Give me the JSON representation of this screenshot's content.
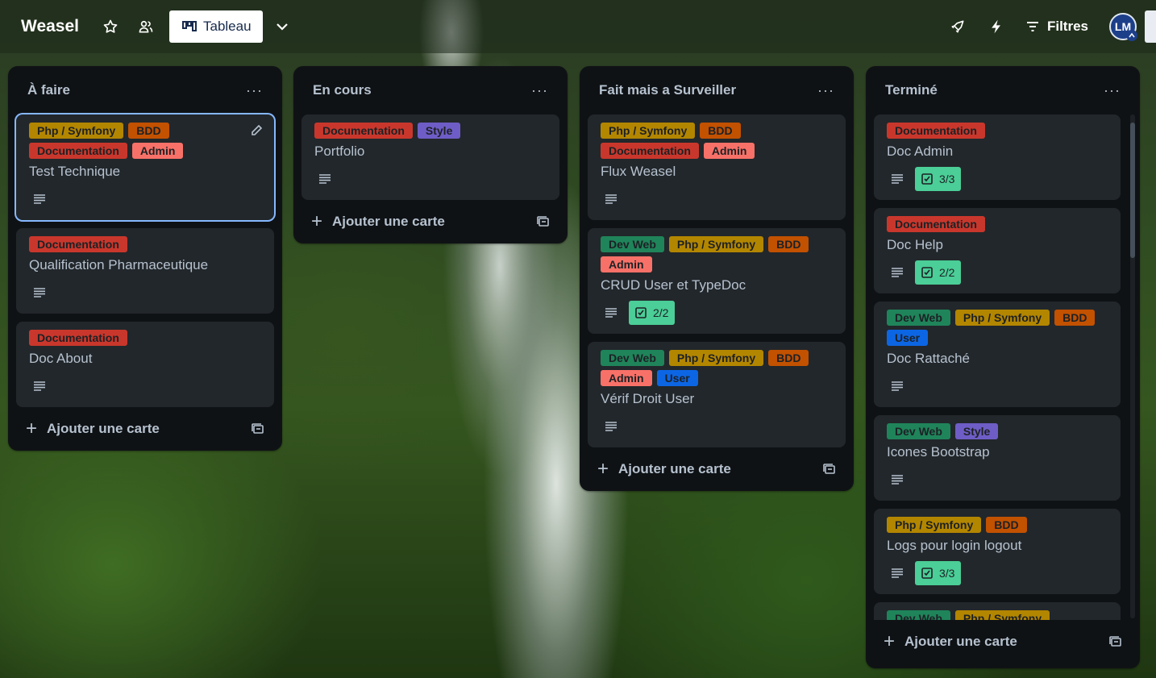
{
  "header": {
    "brand": "Weasel",
    "view_label": "Tableau",
    "filters_label": "Filtres",
    "avatar_initials": "LM",
    "icons": [
      "star-icon",
      "workspace-visibility-icon",
      "board-view-icon",
      "chevron-down-icon",
      "power-ups-icon",
      "automation-icon",
      "filter-icon"
    ]
  },
  "label_colors": {
    "Php / Symfony": "#b38600",
    "BDD": "#c25100",
    "Documentation": "#c9372c",
    "Admin": "#f87168",
    "Style": "#6e5dc6",
    "Dev Web": "#1f845a",
    "User": "#0c66e4"
  },
  "lists": [
    {
      "title": "À faire",
      "menu": "···",
      "add_label": "Ajouter une carte",
      "cards": [
        {
          "labels": [
            "Php / Symfony",
            "BDD",
            "Documentation",
            "Admin"
          ],
          "title": "Test Technique",
          "checklist": null,
          "selected": true
        },
        {
          "labels": [
            "Documentation"
          ],
          "title": "Qualification Pharmaceutique",
          "checklist": null
        },
        {
          "labels": [
            "Documentation"
          ],
          "title": "Doc About",
          "checklist": null
        }
      ]
    },
    {
      "title": "En cours",
      "menu": "···",
      "add_label": "Ajouter une carte",
      "cards": [
        {
          "labels": [
            "Documentation",
            "Style"
          ],
          "title": "Portfolio",
          "checklist": null
        }
      ]
    },
    {
      "title": "Fait mais a Surveiller",
      "menu": "···",
      "add_label": "Ajouter une carte",
      "cards": [
        {
          "labels": [
            "Php / Symfony",
            "BDD",
            "Documentation",
            "Admin"
          ],
          "title": "Flux Weasel",
          "checklist": null
        },
        {
          "labels": [
            "Dev Web",
            "Php / Symfony",
            "BDD",
            "Admin"
          ],
          "title": "CRUD User et TypeDoc",
          "checklist": "2/2"
        },
        {
          "labels": [
            "Dev Web",
            "Php / Symfony",
            "BDD",
            "Admin",
            "User"
          ],
          "title": "Vérif Droit User",
          "checklist": null
        }
      ]
    },
    {
      "title": "Terminé",
      "menu": "···",
      "add_label": "Ajouter une carte",
      "cards": [
        {
          "labels": [
            "Documentation"
          ],
          "title": "Doc Admin",
          "checklist": "3/3"
        },
        {
          "labels": [
            "Documentation"
          ],
          "title": "Doc Help",
          "checklist": "2/2"
        },
        {
          "labels": [
            "Dev Web",
            "Php / Symfony",
            "BDD",
            "User"
          ],
          "title": "Doc Rattaché",
          "checklist": null
        },
        {
          "labels": [
            "Dev Web",
            "Style"
          ],
          "title": "Icones Bootstrap",
          "checklist": null
        },
        {
          "labels": [
            "Php / Symfony",
            "BDD"
          ],
          "title": "Logs pour login logout",
          "checklist": "3/3"
        },
        {
          "labels": [
            "Dev Web",
            "Php / Symfony"
          ],
          "title": "",
          "checklist": null,
          "partial": true
        }
      ]
    }
  ]
}
